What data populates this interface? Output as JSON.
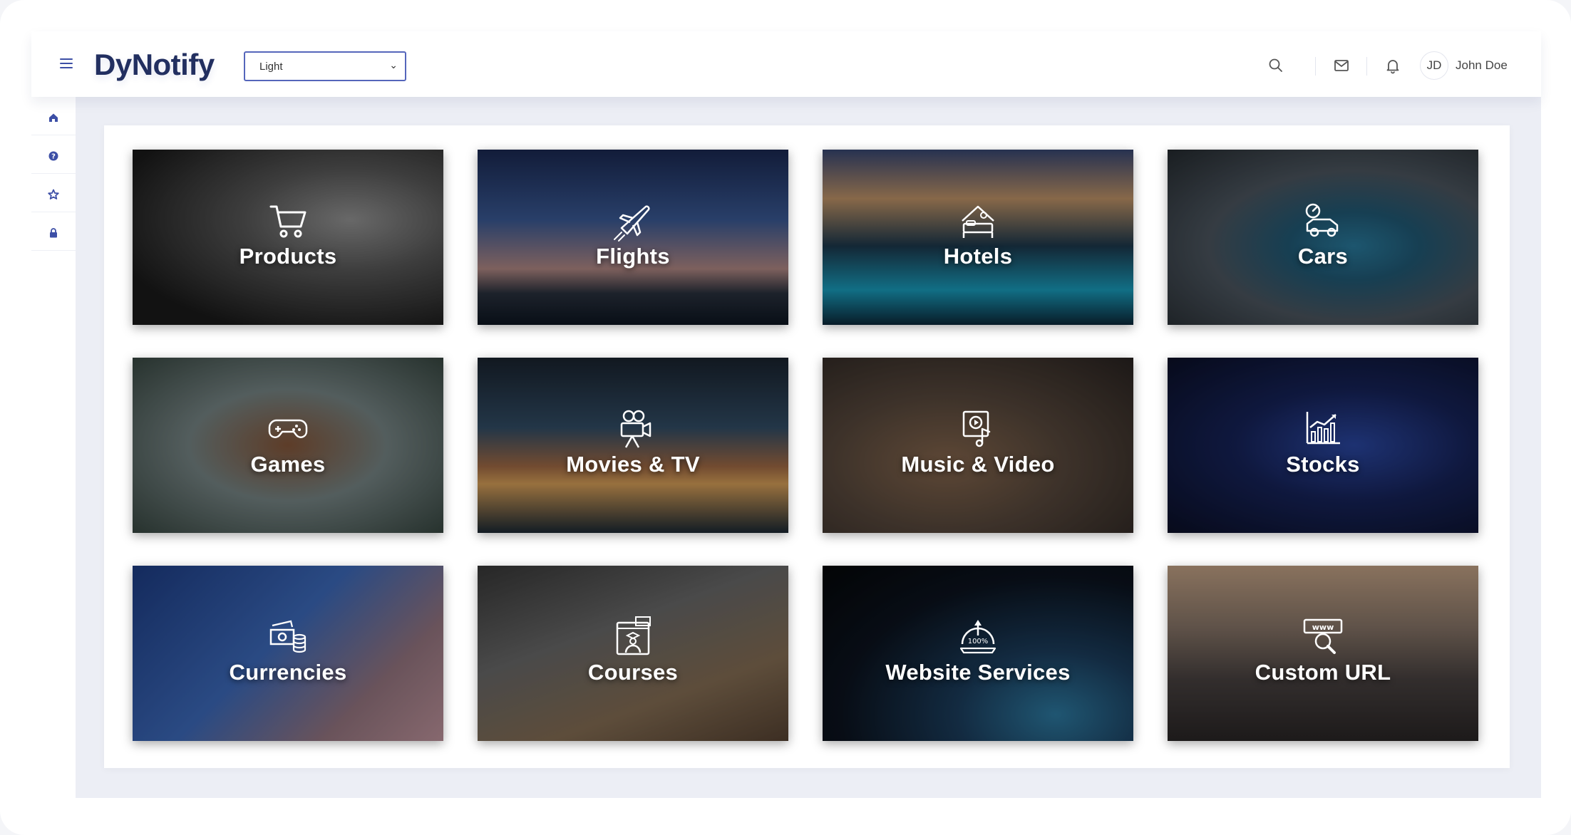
{
  "header": {
    "app_title": "DyNotify",
    "theme_select": {
      "selected": "Light"
    },
    "user": {
      "initials": "JD",
      "name": "John Doe"
    },
    "icons": [
      "menu-icon",
      "search-icon",
      "mail-icon",
      "bell-icon"
    ]
  },
  "sidebar": {
    "items": [
      {
        "icon": "home-icon"
      },
      {
        "icon": "help-icon"
      },
      {
        "icon": "star-icon"
      },
      {
        "icon": "lock-icon"
      }
    ]
  },
  "tiles": [
    {
      "label": "Products",
      "icon": "shopping-cart-icon"
    },
    {
      "label": "Flights",
      "icon": "airplane-icon"
    },
    {
      "label": "Hotels",
      "icon": "hotel-bed-icon"
    },
    {
      "label": "Cars",
      "icon": "car-icon"
    },
    {
      "label": "Games",
      "icon": "gamepad-icon"
    },
    {
      "label": "Movies & TV",
      "icon": "movie-camera-icon"
    },
    {
      "label": "Music & Video",
      "icon": "media-player-icon"
    },
    {
      "label": "Stocks",
      "icon": "stock-chart-icon"
    },
    {
      "label": "Currencies",
      "icon": "money-coins-icon"
    },
    {
      "label": "Courses",
      "icon": "online-course-icon"
    },
    {
      "label": "Website Services",
      "icon": "speedometer-icon"
    },
    {
      "label": "Custom URL",
      "icon": "www-search-icon"
    }
  ],
  "colors": {
    "accent": "#3d4fa6",
    "logo": "#222f60",
    "background": "#eceef5"
  }
}
